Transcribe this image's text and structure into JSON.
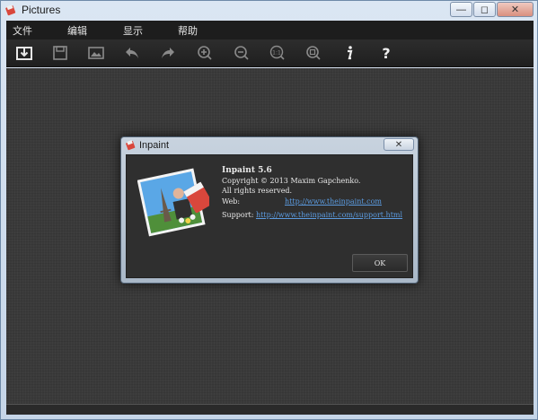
{
  "window": {
    "title": "Pictures",
    "buttons": {
      "minimize": "—",
      "maximize": "◻",
      "close": "✕"
    }
  },
  "menu": {
    "items": [
      "文件",
      "编辑",
      "显示",
      "帮助"
    ]
  },
  "toolbar": {
    "tools": [
      "open-icon",
      "save-icon",
      "image-icon",
      "undo-icon",
      "redo-icon",
      "zoom-in-icon",
      "zoom-out-icon",
      "zoom-actual-icon",
      "zoom-fit-icon",
      "info-icon",
      "help-icon"
    ]
  },
  "dialog": {
    "title": "Inpaint",
    "close_label": "✕",
    "app_name": "Inpaint 5.6",
    "copyright": "Copyright © 2013 Maxim Gapchenko.",
    "rights": "All rights reserved.",
    "web_label": "Web:",
    "web_url": "http://www.theinpaint.com",
    "support_label": "Support:",
    "support_url": "http://www.theinpaint.com/support.html",
    "ok_label": "OK"
  },
  "colors": {
    "canvas": "#3a3a3a",
    "menubar": "#1d1d1d",
    "link": "#5b9be0"
  }
}
